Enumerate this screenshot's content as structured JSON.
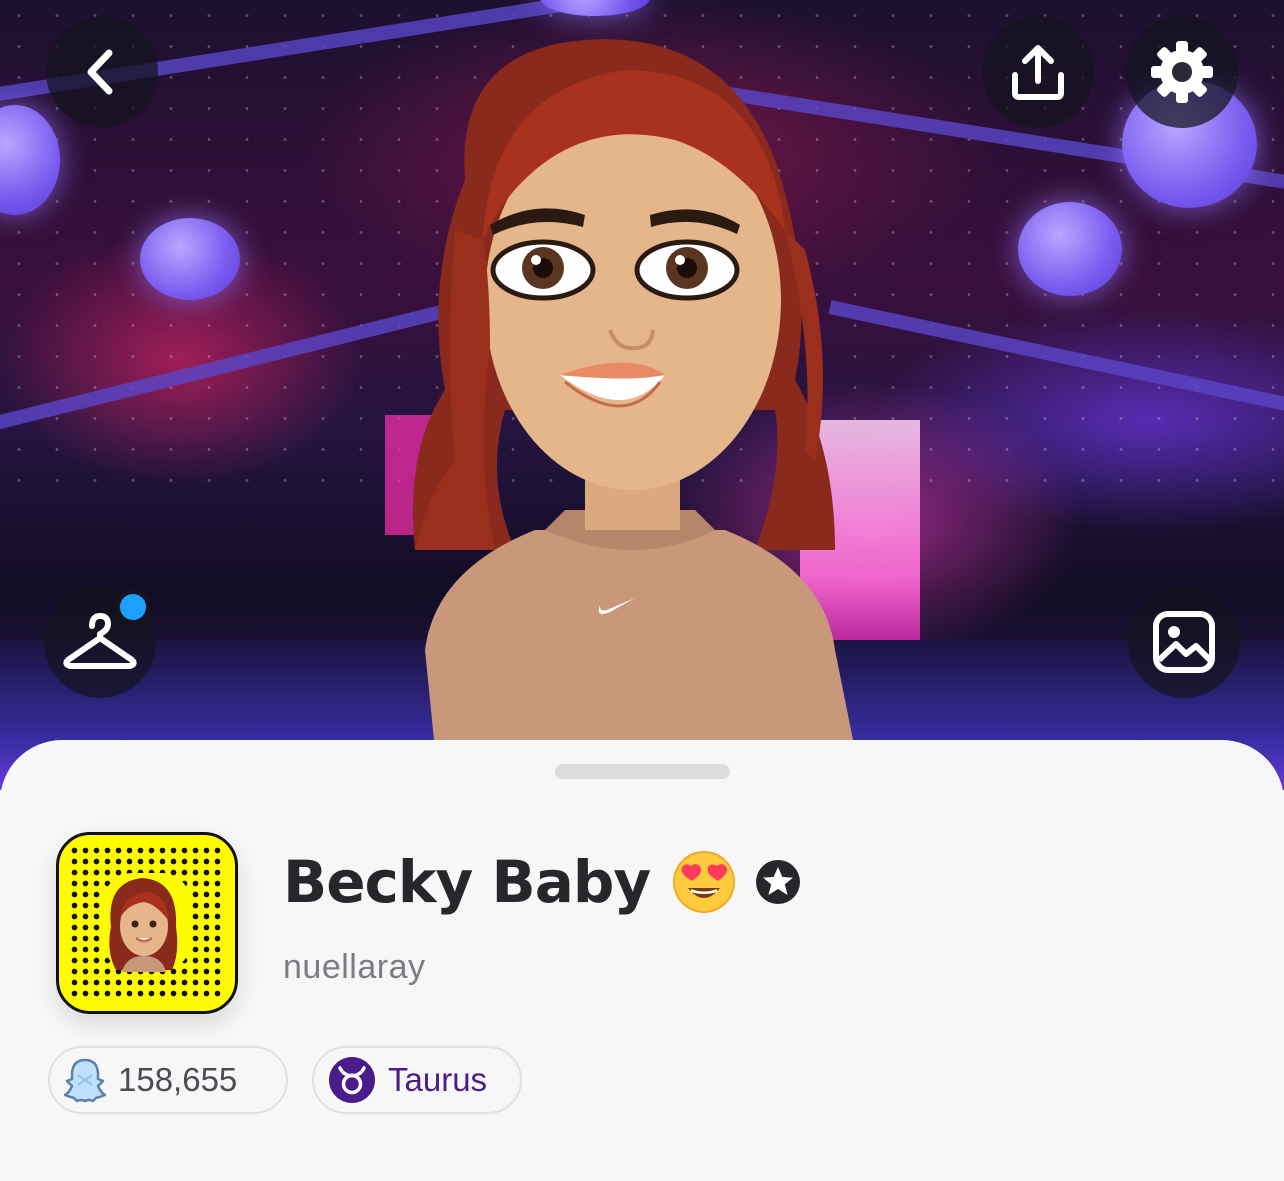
{
  "header": {
    "back_icon": "chevron-left-icon",
    "share_icon": "upload-share-icon",
    "settings_icon": "gear-icon",
    "outfit_icon": "hanger-icon",
    "outfit_has_notification": true,
    "gallery_icon": "photo-gallery-icon",
    "notification_color": "#1ea0ff"
  },
  "profile": {
    "display_name": "Becky Baby",
    "name_emoji": "heart-eyes-emoji",
    "verified_icon": "star-badge-icon",
    "username": "nuellaray",
    "snapcode_color": "#fffc00"
  },
  "chips": {
    "score": {
      "icon": "snap-score-ghost-icon",
      "value": "158,655"
    },
    "zodiac": {
      "icon": "taurus-icon",
      "label": "Taurus",
      "color": "#4b1d8c"
    }
  }
}
